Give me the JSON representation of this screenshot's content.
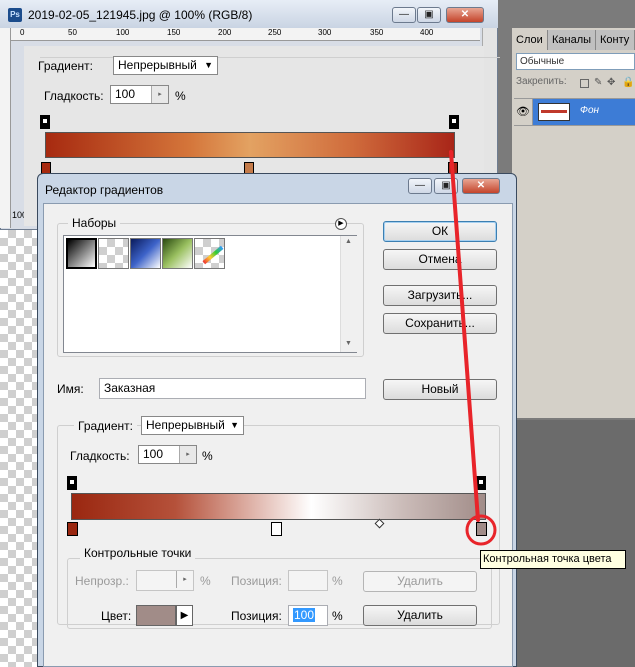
{
  "ps_window": {
    "title": "2019-02-05_121945.jpg @ 100% (RGB/8)",
    "ruler_ticks": [
      "0",
      "50",
      "100",
      "150",
      "200",
      "250",
      "300",
      "350",
      "400"
    ],
    "zoom_label": "100%",
    "gradient_label": "Градиент:",
    "gradient_type": "Непрерывный",
    "smoothness_label": "Гладкость:",
    "smoothness_value": "100",
    "percent": "%"
  },
  "panel": {
    "tabs": [
      "Слои",
      "Каналы",
      "Конту"
    ],
    "blend_mode": "Обычные",
    "lock_label": "Закрепить:",
    "layer_name": "Фон"
  },
  "dialog": {
    "title": "Редактор градиентов",
    "presets_label": "Наборы",
    "buttons": {
      "ok": "ОК",
      "cancel": "Отмена",
      "load": "Загрузить...",
      "save": "Сохранить...",
      "new": "Новый"
    },
    "name_label": "Имя:",
    "name_value": "Заказная",
    "gradient_label": "Градиент:",
    "gradient_type": "Непрерывный",
    "smoothness_label": "Гладкость:",
    "smoothness_value": "100",
    "percent": "%",
    "stops_group_label": "Контрольные точки",
    "opacity_label": "Непрозр.:",
    "position_label": "Позиция:",
    "delete_label": "Удалить",
    "color_label": "Цвет:",
    "color_position_value": "100",
    "color_swatch": "#a18c88"
  },
  "tooltip": "Контрольная точка цвета",
  "colors": {
    "accent_annotation": "#e8242a",
    "layer_highlight": "#3d7cd6"
  }
}
